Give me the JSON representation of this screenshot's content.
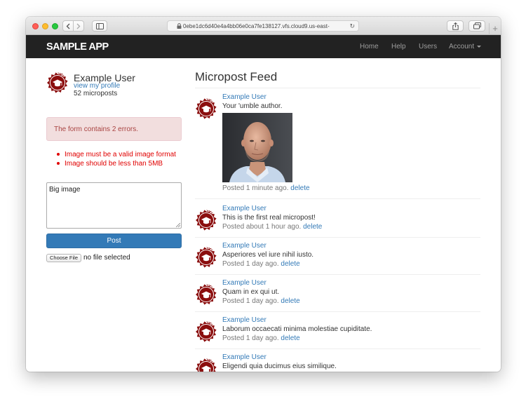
{
  "browser": {
    "url": "0ebe1dc6d40e4a4bb06e0ca7fe138127.vfs.cloud9.us-east-"
  },
  "navbar": {
    "logo": "SAMPLE APP",
    "links": [
      {
        "label": "Home"
      },
      {
        "label": "Help"
      },
      {
        "label": "Users"
      },
      {
        "label": "Account"
      }
    ]
  },
  "sidebar": {
    "user_name": "Example User",
    "profile_link": "view my profile",
    "micropost_count": "52 microposts",
    "error_summary": "The form contains 2 errors.",
    "errors": [
      "Image must be a valid image format",
      "Image should be less than 5MB"
    ],
    "textarea_value": "Big image",
    "post_button": "Post",
    "choose_file": "Choose File",
    "file_status": "no file selected"
  },
  "feed": {
    "title": "Micropost Feed",
    "posts": [
      {
        "user": "Example User",
        "content": "Your 'umble author.",
        "timestamp": "Posted 1 minute ago.",
        "delete": "delete"
      },
      {
        "user": "Example User",
        "content": "This is the first real micropost!",
        "timestamp": "Posted about 1 hour ago.",
        "delete": "delete"
      },
      {
        "user": "Example User",
        "content": "Asperiores vel iure nihil iusto.",
        "timestamp": "Posted 1 day ago.",
        "delete": "delete"
      },
      {
        "user": "Example User",
        "content": "Quam in ex qui ut.",
        "timestamp": "Posted 1 day ago.",
        "delete": "delete"
      },
      {
        "user": "Example User",
        "content": "Laborum occaecati minima molestiae cupiditate.",
        "timestamp": "Posted 1 day ago.",
        "delete": "delete"
      },
      {
        "user": "Example User",
        "content": "Eligendi quia ducimus eius similique.",
        "timestamp": "",
        "delete": ""
      }
    ]
  },
  "colors": {
    "navbar_bg": "#222222",
    "link": "#337ab7",
    "error_text": "#e00000",
    "alert_bg": "#f2dede",
    "alert_text": "#a94442",
    "avatar": "#8b0e0e"
  },
  "icons": [
    "lock-icon",
    "reload-icon",
    "share-icon",
    "tabs-icon",
    "sidebar-icon",
    "chevron-left-icon",
    "chevron-right-icon",
    "caret-down-icon",
    "gravatar-icon"
  ]
}
